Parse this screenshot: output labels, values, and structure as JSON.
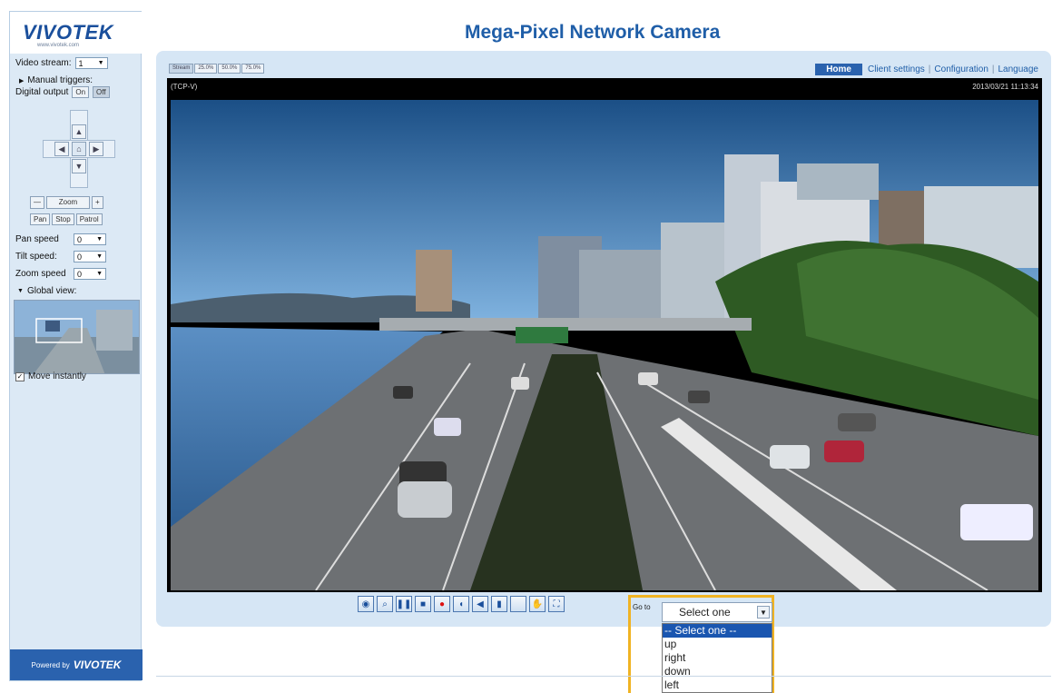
{
  "logo": {
    "brand": "VIVOTEK",
    "tagline": "www.vivotek.com"
  },
  "header": {
    "title": "Mega-Pixel Network Camera"
  },
  "nav": {
    "home": "Home",
    "client_settings": "Client settings",
    "configuration": "Configuration",
    "language": "Language"
  },
  "view_tabs": [
    "Stream",
    "25.0%",
    "50.0%",
    "75.0%"
  ],
  "video": {
    "protocol": "(TCP-V)",
    "timestamp": "2013/03/21 11:13:34"
  },
  "sidebar": {
    "video_stream_label": "Video stream:",
    "video_stream_value": "1",
    "manual_triggers": "Manual triggers:",
    "digital_output": "Digital output",
    "do_on": "On",
    "do_off": "Off",
    "zoom_out": "—",
    "zoom_label": "Zoom",
    "zoom_in": "+",
    "pan_btn": "Pan",
    "stop_btn": "Stop",
    "patrol_btn": "Patrol",
    "pan_speed_label": "Pan speed",
    "pan_speed_value": "0",
    "tilt_speed_label": "Tilt speed:",
    "tilt_speed_value": "0",
    "zoom_speed_label": "Zoom speed",
    "zoom_speed_value": "0",
    "global_view": "Global view:",
    "move_instantly": "Move instantly"
  },
  "footer": {
    "powered_by": "Powered by",
    "powered_brand": "VIVOTEK"
  },
  "goto": {
    "label": "Go to",
    "selected": "Select one",
    "options": [
      "-- Select one --",
      "up",
      "right",
      "down",
      "left"
    ]
  },
  "colors": {
    "brand_blue": "#1f5ea8",
    "highlight": "#f0b323",
    "panel": "#d6e6f5"
  }
}
